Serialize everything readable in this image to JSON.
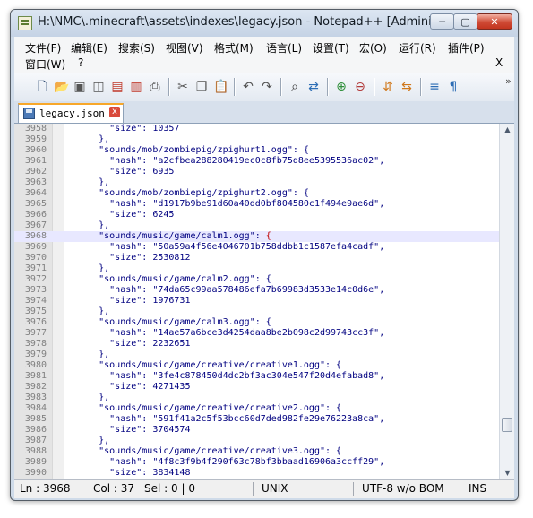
{
  "window": {
    "title": "H:\\NMC\\.minecraft\\assets\\indexes\\legacy.json - Notepad++ [Administr..."
  },
  "controls": {
    "minimize": "─",
    "maximize": "▢",
    "close": "✕"
  },
  "menu": {
    "items": [
      "文件(F)",
      "编辑(E)",
      "搜索(S)",
      "视图(V)",
      "格式(M)",
      "语言(L)",
      "设置(T)",
      "宏(O)",
      "运行(R)",
      "插件(P)",
      "窗口(W)",
      "?"
    ],
    "close_label": "X"
  },
  "toolbar": {
    "icons": [
      "new-file-icon",
      "open-file-icon",
      "save-icon",
      "save-all-icon",
      "close-icon",
      "close-all-icon",
      "print-icon",
      "cut-icon",
      "copy-icon",
      "paste-icon",
      "undo-icon",
      "redo-icon",
      "find-icon",
      "replace-icon",
      "zoom-in-icon",
      "zoom-out-icon",
      "sync-vertical-icon",
      "sync-horizontal-icon",
      "word-wrap-icon",
      "show-all-chars-icon"
    ],
    "overflow": "»"
  },
  "tabs": [
    {
      "label": "legacy.json",
      "close": "x"
    }
  ],
  "editor": {
    "lines": [
      {
        "n": "3958",
        "t": "        \"size\": 10357"
      },
      {
        "n": "3959",
        "t": "      },"
      },
      {
        "n": "3960",
        "t": "      \"sounds/mob/zombiepig/zpighurt1.ogg\": {"
      },
      {
        "n": "3961",
        "t": "        \"hash\": \"a2cfbea288280419ec0c8fb75d8ee5395536ac02\","
      },
      {
        "n": "3962",
        "t": "        \"size\": 6935"
      },
      {
        "n": "3963",
        "t": "      },"
      },
      {
        "n": "3964",
        "t": "      \"sounds/mob/zombiepig/zpighurt2.ogg\": {"
      },
      {
        "n": "3965",
        "t": "        \"hash\": \"d1917b9be91d60a40dd0bf804580c1f494e9ae6d\","
      },
      {
        "n": "3966",
        "t": "        \"size\": 6245"
      },
      {
        "n": "3967",
        "t": "      },"
      },
      {
        "n": "3968",
        "t": "      \"sounds/music/game/calm1.ogg\": {"
      },
      {
        "n": "3969",
        "t": "        \"hash\": \"50a59a4f56e4046701b758ddbb1c1587efa4cadf\","
      },
      {
        "n": "3970",
        "t": "        \"size\": 2530812"
      },
      {
        "n": "3971",
        "t": "      },"
      },
      {
        "n": "3972",
        "t": "      \"sounds/music/game/calm2.ogg\": {"
      },
      {
        "n": "3973",
        "t": "        \"hash\": \"74da65c99aa578486efa7b69983d3533e14c0d6e\","
      },
      {
        "n": "3974",
        "t": "        \"size\": 1976731"
      },
      {
        "n": "3975",
        "t": "      },"
      },
      {
        "n": "3976",
        "t": "      \"sounds/music/game/calm3.ogg\": {"
      },
      {
        "n": "3977",
        "t": "        \"hash\": \"14ae57a6bce3d4254daa8be2b098c2d99743cc3f\","
      },
      {
        "n": "3978",
        "t": "        \"size\": 2232651"
      },
      {
        "n": "3979",
        "t": "      },"
      },
      {
        "n": "3980",
        "t": "      \"sounds/music/game/creative/creative1.ogg\": {"
      },
      {
        "n": "3981",
        "t": "        \"hash\": \"3fe4c878450d4dc2bf3ac304e547f20d4efabad8\","
      },
      {
        "n": "3982",
        "t": "        \"size\": 4271435"
      },
      {
        "n": "3983",
        "t": "      },"
      },
      {
        "n": "3984",
        "t": "      \"sounds/music/game/creative/creative2.ogg\": {"
      },
      {
        "n": "3985",
        "t": "        \"hash\": \"591f41a2c5f53bcc60d7ded982fe29e76223a8ca\","
      },
      {
        "n": "3986",
        "t": "        \"size\": 3704574"
      },
      {
        "n": "3987",
        "t": "      },"
      },
      {
        "n": "3988",
        "t": "      \"sounds/music/game/creative/creative3.ogg\": {"
      },
      {
        "n": "3989",
        "t": "        \"hash\": \"4f8c3f9b4f290f63c78bf3bbaad16906a3ccff29\","
      },
      {
        "n": "3990",
        "t": "        \"size\": 3834148"
      }
    ],
    "current_line": "3968"
  },
  "status": {
    "ln": "Ln : 3968",
    "col": "Col : 37",
    "sel": "Sel : 0 | 0",
    "eol": "UNIX",
    "encoding": "UTF-8 w/o BOM",
    "mode": "INS"
  }
}
